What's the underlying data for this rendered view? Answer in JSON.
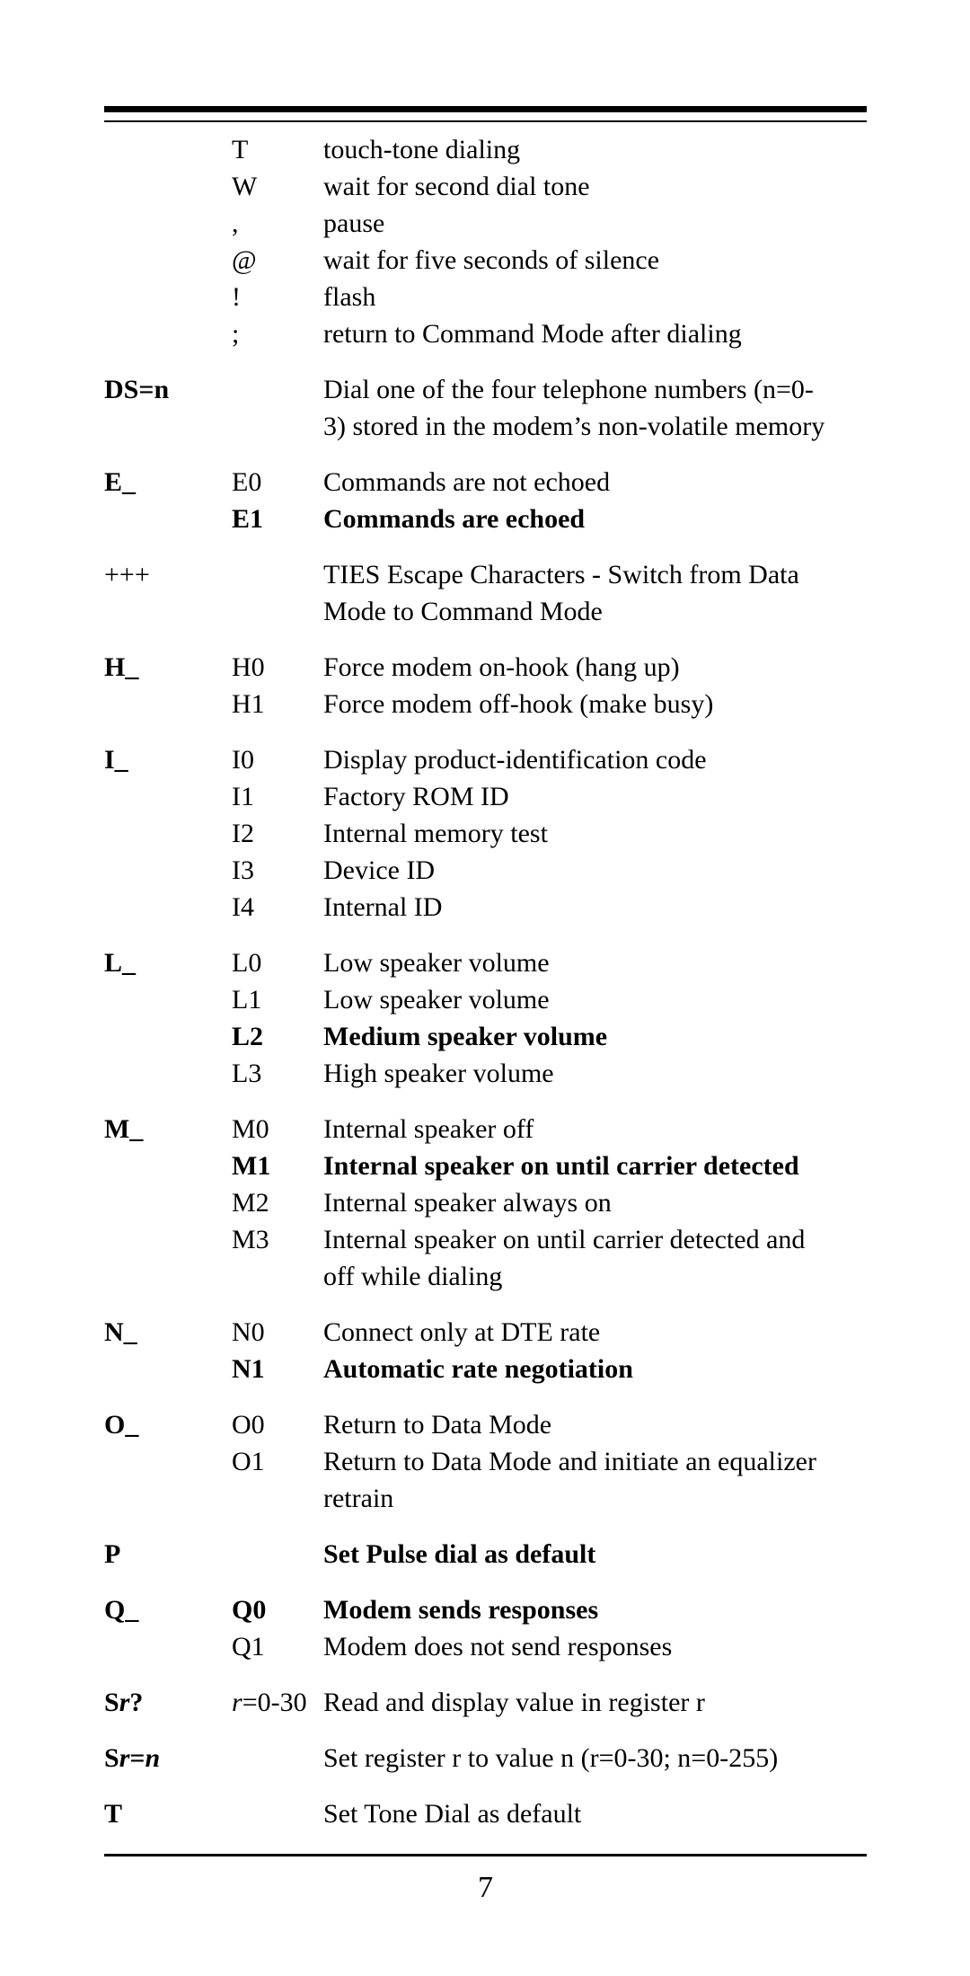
{
  "page": {
    "number": "7",
    "rules": {
      "top_thick": true,
      "top_thin": true,
      "bottom_thin": true
    }
  },
  "table": {
    "groups": [
      {
        "command": "",
        "rows": [
          {
            "param": "T",
            "desc": "touch-tone dialing",
            "bold": false
          },
          {
            "param": "W",
            "desc": "wait for second dial tone",
            "bold": false
          },
          {
            "param": ",",
            "desc": "pause",
            "bold": false
          },
          {
            "param": "@",
            "desc": "wait for five seconds of silence",
            "bold": false
          },
          {
            "param": "!",
            "desc": "flash",
            "bold": false
          },
          {
            "param": ";",
            "desc": "return to Command Mode after dialing",
            "bold": false
          }
        ]
      },
      {
        "command": "DS=n",
        "rows": [
          {
            "param": "",
            "desc": "Dial one of the four telephone numbers (n=0-",
            "desc2": "3) stored in the modem’s non-volatile memory",
            "bold": false
          }
        ]
      },
      {
        "command": "E_",
        "rows": [
          {
            "param": "E0",
            "desc": "Commands are not echoed",
            "bold": false
          },
          {
            "param": "E1",
            "desc": "Commands are echoed",
            "bold": true
          }
        ]
      },
      {
        "command": "+++",
        "command_bold": false,
        "rows": [
          {
            "param": "",
            "desc": "TIES Escape Characters - Switch from Data",
            "desc2": "Mode to Command Mode",
            "bold": false
          }
        ]
      },
      {
        "command": "H_",
        "rows": [
          {
            "param": "H0",
            "desc": "Force modem on-hook (hang up)",
            "bold": false
          },
          {
            "param": "H1",
            "desc": "Force modem off-hook (make busy)",
            "bold": false
          }
        ]
      },
      {
        "command": "I_",
        "rows": [
          {
            "param": "I0",
            "desc": "Display product-identification code",
            "bold": false
          },
          {
            "param": "I1",
            "desc": "Factory ROM ID",
            "bold": false
          },
          {
            "param": "I2",
            "desc": "Internal memory test",
            "bold": false
          },
          {
            "param": "I3",
            "desc": "Device ID",
            "bold": false
          },
          {
            "param": "I4",
            "desc": "Internal ID",
            "bold": false
          }
        ]
      },
      {
        "command": "L_",
        "rows": [
          {
            "param": "L0",
            "desc": "Low speaker volume",
            "bold": false
          },
          {
            "param": "L1",
            "desc": "Low speaker volume",
            "bold": false
          },
          {
            "param": "L2",
            "desc": "Medium speaker volume",
            "bold": true
          },
          {
            "param": "L3",
            "desc": "High speaker volume",
            "bold": false
          }
        ]
      },
      {
        "command": "M_",
        "rows": [
          {
            "param": "M0",
            "desc": "Internal speaker off",
            "bold": false
          },
          {
            "param": "M1",
            "desc": "Internal speaker on until carrier detected",
            "bold": true
          },
          {
            "param": "M2",
            "desc": "Internal speaker always on",
            "bold": false
          },
          {
            "param": "M3",
            "desc": "Internal speaker on until carrier detected and",
            "desc2": "off while dialing",
            "bold": false
          }
        ]
      },
      {
        "command": "N_",
        "rows": [
          {
            "param": "N0",
            "desc": "Connect only at DTE rate",
            "bold": false
          },
          {
            "param": "N1",
            "desc": "Automatic rate negotiation",
            "bold": true
          }
        ]
      },
      {
        "command": "O_",
        "rows": [
          {
            "param": "O0",
            "desc": "Return to Data Mode",
            "bold": false
          },
          {
            "param": "O1",
            "desc": "Return to Data Mode and initiate an equalizer",
            "desc2": "retrain",
            "bold": false
          }
        ]
      },
      {
        "command": "P",
        "rows": [
          {
            "param": "",
            "desc": "Set Pulse dial as default",
            "bold": true
          }
        ]
      },
      {
        "command": "Q_",
        "rows": [
          {
            "param": "Q0",
            "desc": "Modem sends responses",
            "bold": true
          },
          {
            "param": "Q1",
            "desc": "Modem does not send responses",
            "bold": false
          }
        ]
      },
      {
        "command_parts": [
          {
            "text": "S",
            "style": "bold"
          },
          {
            "text": "r",
            "style": "bold-italic"
          },
          {
            "text": "?",
            "style": "bold"
          }
        ],
        "command": "Sr?",
        "rows": [
          {
            "param_parts": [
              {
                "text": "r",
                "style": "italic"
              },
              {
                "text": "=0-30",
                "style": "normal"
              }
            ],
            "param": "r=0-30",
            "desc": "Read and display value in register r",
            "bold": false,
            "narrow_param": true
          }
        ]
      },
      {
        "command_parts": [
          {
            "text": "S",
            "style": "bold"
          },
          {
            "text": "r",
            "style": "bold-italic"
          },
          {
            "text": "=",
            "style": "bold"
          },
          {
            "text": "n",
            "style": "bold-italic"
          }
        ],
        "command": "Sr=n",
        "rows": [
          {
            "param": "",
            "desc": "Set register r to value n (r=0-30; n=0-255)",
            "bold": false
          }
        ]
      },
      {
        "command": "T",
        "rows": [
          {
            "param": "",
            "desc": "Set Tone Dial as default",
            "bold": false
          }
        ]
      }
    ]
  }
}
